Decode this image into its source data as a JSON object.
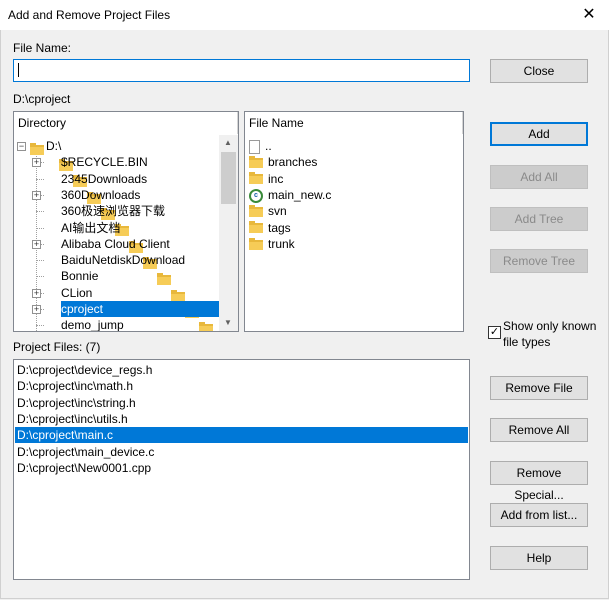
{
  "window": {
    "title": "Add and Remove Project Files",
    "close_glyph": "✕"
  },
  "file_name": {
    "label": "File Name:",
    "value": ""
  },
  "current_path": "D:\\cproject",
  "directory": {
    "header": "Directory",
    "items": [
      {
        "label": "D:\\",
        "expand": "−"
      },
      {
        "label": "$RECYCLE.BIN",
        "expand": "+"
      },
      {
        "label": "2345Downloads",
        "expand": ""
      },
      {
        "label": "360Downloads",
        "expand": "+"
      },
      {
        "label": "360极速浏览器下载",
        "expand": ""
      },
      {
        "label": "AI输出文档",
        "expand": ""
      },
      {
        "label": "Alibaba Cloud Client",
        "expand": "+"
      },
      {
        "label": "BaiduNetdiskDownload",
        "expand": ""
      },
      {
        "label": "Bonnie",
        "expand": ""
      },
      {
        "label": "CLion",
        "expand": "+"
      },
      {
        "label": "cproject",
        "expand": "+",
        "selected": true
      },
      {
        "label": "demo_jump",
        "expand": ""
      }
    ]
  },
  "files": {
    "header": "File Name",
    "items": [
      {
        "label": "..",
        "icon": "file-icon"
      },
      {
        "label": "branches",
        "icon": "folder-icon"
      },
      {
        "label": "inc",
        "icon": "folder-icon"
      },
      {
        "label": "main_new.c",
        "icon": "c-file-icon"
      },
      {
        "label": "svn",
        "icon": "folder-icon"
      },
      {
        "label": "tags",
        "icon": "folder-icon"
      },
      {
        "label": "trunk",
        "icon": "folder-icon"
      }
    ]
  },
  "buttons": {
    "close": "Close",
    "add": "Add",
    "add_all": "Add All",
    "add_tree": "Add Tree",
    "remove_tree": "Remove Tree",
    "remove_file": "Remove File",
    "remove_all": "Remove All",
    "remove_special": "Remove Special...",
    "add_from_list": "Add from list...",
    "help": "Help"
  },
  "show_known": {
    "label_line1": "Show only known",
    "label_line2": "file types",
    "checked": true,
    "check_glyph": "✓"
  },
  "project_files": {
    "label": "Project Files: (7)",
    "items": [
      {
        "path": "D:\\cproject\\device_regs.h"
      },
      {
        "path": "D:\\cproject\\inc\\math.h"
      },
      {
        "path": "D:\\cproject\\inc\\string.h"
      },
      {
        "path": "D:\\cproject\\inc\\utils.h"
      },
      {
        "path": "D:\\cproject\\main.c",
        "selected": true
      },
      {
        "path": "D:\\cproject\\main_device.c"
      },
      {
        "path": "D:\\cproject\\New0001.cpp"
      }
    ]
  },
  "colors": {
    "selection": "#0078d7",
    "folder": "#f6cc57"
  }
}
